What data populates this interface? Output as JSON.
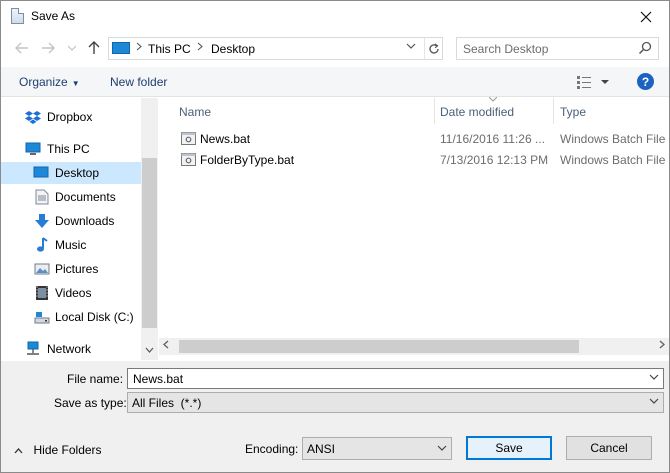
{
  "window": {
    "title": "Save As"
  },
  "nav": {
    "address": {
      "segments": [
        "This PC",
        "Desktop"
      ]
    },
    "search": {
      "placeholder": "Search Desktop"
    }
  },
  "toolbar": {
    "organize_label": "Organize",
    "new_folder_label": "New folder"
  },
  "navpane": {
    "items": [
      {
        "label": "Dropbox",
        "icon": "dropbox-icon"
      },
      {
        "label": "This PC",
        "icon": "computer-icon"
      },
      {
        "label": "Desktop",
        "icon": "desktop-icon",
        "selected": true
      },
      {
        "label": "Documents",
        "icon": "documents-icon"
      },
      {
        "label": "Downloads",
        "icon": "download-icon"
      },
      {
        "label": "Music",
        "icon": "music-icon"
      },
      {
        "label": "Pictures",
        "icon": "pictures-icon"
      },
      {
        "label": "Videos",
        "icon": "videos-icon"
      },
      {
        "label": "Local Disk (C:)",
        "icon": "drive-icon"
      },
      {
        "label": "Network",
        "icon": "network-icon"
      }
    ]
  },
  "filelist": {
    "columns": [
      "Name",
      "Date modified",
      "Type"
    ],
    "files": [
      {
        "name": "News.bat",
        "date": "11/16/2016 11:26 ...",
        "type": "Windows Batch File"
      },
      {
        "name": "FolderByType.bat",
        "date": "7/13/2016 12:13 PM",
        "type": "Windows Batch File"
      }
    ]
  },
  "form": {
    "filename_label": "File name:",
    "filename_value": "News.bat",
    "savetype_label": "Save as type:",
    "savetype_value": "All Files  (*.*)",
    "encoding_label": "Encoding:",
    "encoding_value": "ANSI"
  },
  "footer": {
    "hide_folders_label": "Hide Folders",
    "save_label": "Save",
    "cancel_label": "Cancel"
  },
  "colors": {
    "accent": "#0078d7",
    "selection": "#cce8ff",
    "link_text": "#1e3f71"
  }
}
